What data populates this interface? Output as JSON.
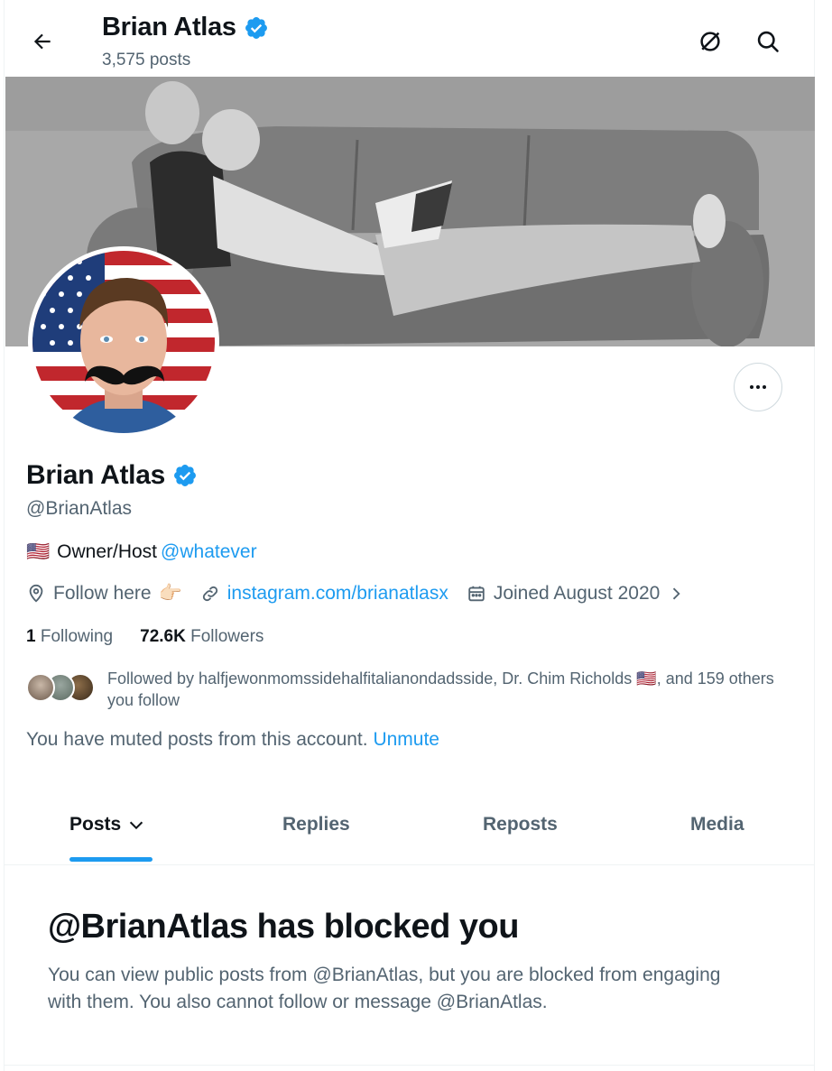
{
  "header": {
    "name": "Brian Atlas",
    "post_count": "3,575 posts"
  },
  "profile": {
    "name": "Brian Atlas",
    "handle": "@BrianAtlas",
    "bio_flag": "🇺🇸",
    "bio_text": "Owner/Host",
    "bio_mention": "@whatever",
    "location": "Follow here",
    "location_emoji": "👉🏻",
    "website": "instagram.com/brianatlasx",
    "joined": "Joined August 2020",
    "following_count": "1",
    "following_label": "Following",
    "followers_count": "72.6K",
    "followers_label": "Followers",
    "followed_by": "Followed by halfjewonmomssidehalfitalianondadsside, Dr. Chim Richolds 🇺🇸, and 159 others you follow",
    "muted_text": "You have muted posts from this account.",
    "unmute_label": "Unmute"
  },
  "tabs": [
    {
      "label": "Posts",
      "active": true
    },
    {
      "label": "Replies",
      "active": false
    },
    {
      "label": "Reposts",
      "active": false
    },
    {
      "label": "Media",
      "active": false
    }
  ],
  "blocked": {
    "title": "@BrianAtlas has blocked you",
    "body": "You can view public posts from @BrianAtlas, but you are blocked from engaging with them. You also cannot follow or message @BrianAtlas."
  },
  "colors": {
    "accent": "#1d9bf0",
    "text_primary": "#0f1419",
    "text_secondary": "#536471",
    "verified": "#1d9bf0"
  },
  "icons": {
    "back": "arrow-left-icon",
    "verified": "verified-badge-icon",
    "grok": "slashed-circle-icon",
    "search": "search-icon",
    "more": "more-horizontal-icon",
    "location": "location-pin-icon",
    "link": "link-icon",
    "calendar": "calendar-icon",
    "chevron": "chevron-right-icon",
    "tab_chevron": "chevron-down-icon"
  }
}
